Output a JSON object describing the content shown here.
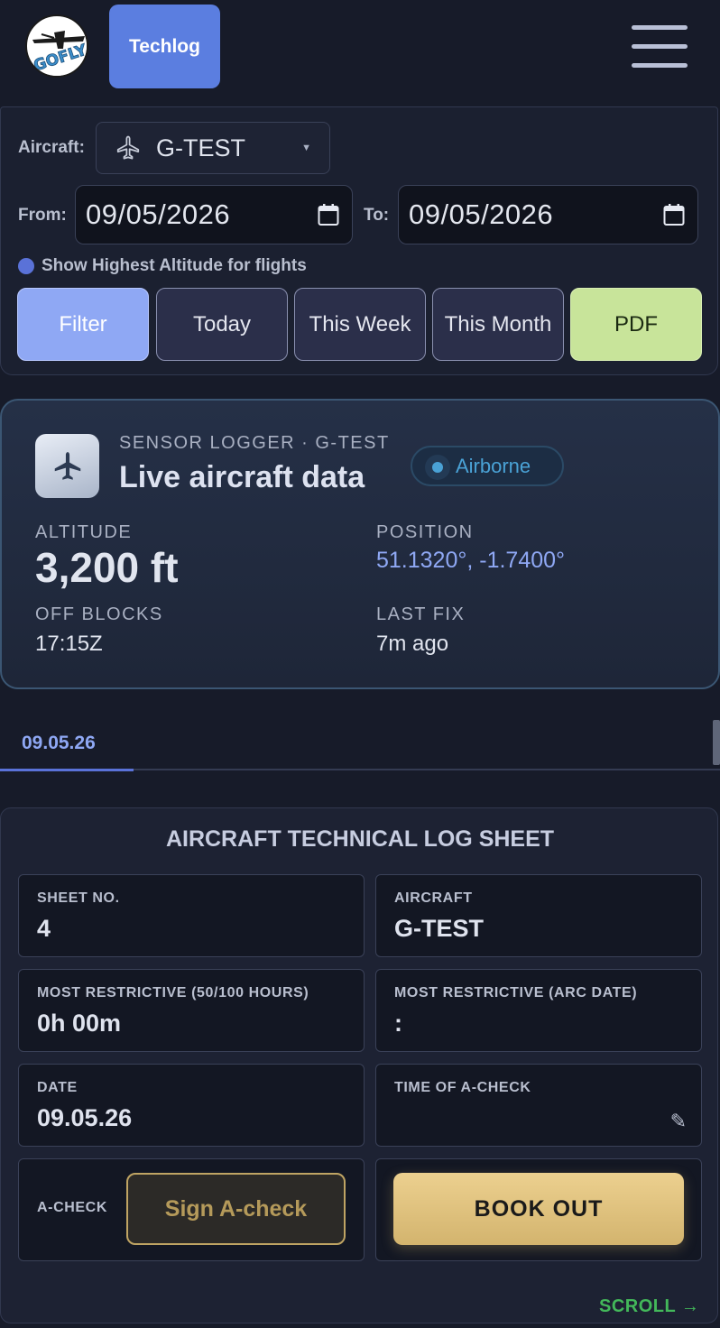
{
  "header": {
    "logo_text": "GOFLY",
    "tab_label": "Techlog"
  },
  "filters": {
    "aircraft_label": "Aircraft:",
    "aircraft_value": "G-TEST",
    "from_label": "From:",
    "from_value": "09/05/2026",
    "to_label": "To:",
    "to_value": "09/05/2026",
    "toggle_label": "Show Highest Altitude for flights",
    "buttons": {
      "filter": "Filter",
      "today": "Today",
      "this_week": "This Week",
      "this_month": "This Month",
      "pdf": "PDF"
    }
  },
  "live": {
    "subtitle": "SENSOR LOGGER · G-TEST",
    "title": "Live aircraft data",
    "status": "Airborne",
    "altitude_label": "ALTITUDE",
    "altitude_value": "3,200 ft",
    "position_label": "POSITION",
    "position_value": "51.1320°, -1.7400°",
    "off_blocks_label": "OFF BLOCKS",
    "off_blocks_value": "17:15Z",
    "last_fix_label": "LAST FIX",
    "last_fix_value": "7m ago"
  },
  "date_tabs": [
    "09.05.26"
  ],
  "sheet": {
    "title": "AIRCRAFT TECHNICAL LOG SHEET",
    "sheet_no_label": "SHEET NO.",
    "sheet_no_value": "4",
    "aircraft_label": "AIRCRAFT",
    "aircraft_value": "G-TEST",
    "most_restrictive_hours_label": "MOST RESTRICTIVE (50/100 HOURS)",
    "most_restrictive_hours_value": "0h 00m",
    "most_restrictive_arc_label": "MOST RESTRICTIVE (ARC DATE)",
    "most_restrictive_arc_value": ":",
    "date_label": "DATE",
    "date_value": "09.05.26",
    "time_acheck_label": "TIME OF A-CHECK",
    "time_acheck_value": "",
    "acheck_label": "A-CHECK",
    "sign_button": "Sign A-check",
    "book_out_button": "BOOK OUT"
  },
  "scroll_hint": "SCROLL →",
  "colors": {
    "background": "#171b29",
    "accent": "#5b7ee0",
    "filter_primary": "#8fa8f4",
    "pdf": "#c8e49a",
    "airborne": "#4aa2d6",
    "book_out": "#e6c88a",
    "scroll_hint": "#43b85a"
  },
  "icons": {
    "menu": "hamburger-icon",
    "aircraft": "plane-icon",
    "calendar": "calendar-icon",
    "edit": "pencil-icon"
  }
}
